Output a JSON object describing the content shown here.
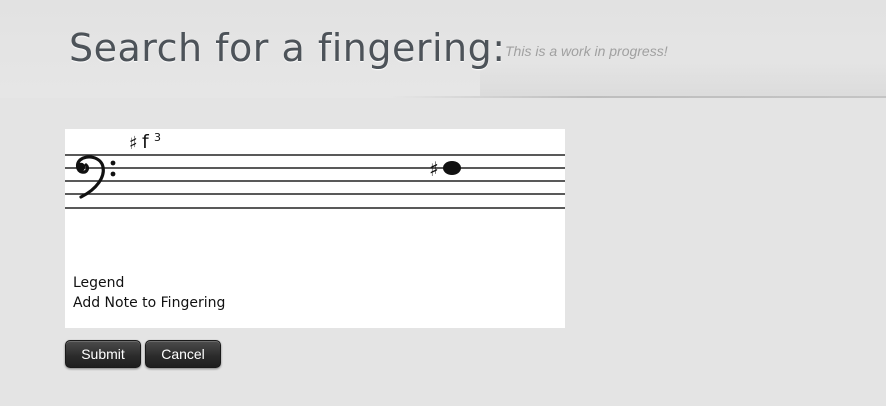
{
  "header": {
    "title": "Search for a fingering:",
    "subtitle": "This is a work in progress!"
  },
  "staff": {
    "clef": "bass",
    "pitch_label": {
      "accidental": "♯",
      "note": "f",
      "octave": "3"
    },
    "note_accidental": "♯"
  },
  "panel": {
    "legend_label": "Legend",
    "add_note_label": "Add Note to Fingering"
  },
  "buttons": {
    "submit_label": "Submit",
    "cancel_label": "Cancel"
  }
}
